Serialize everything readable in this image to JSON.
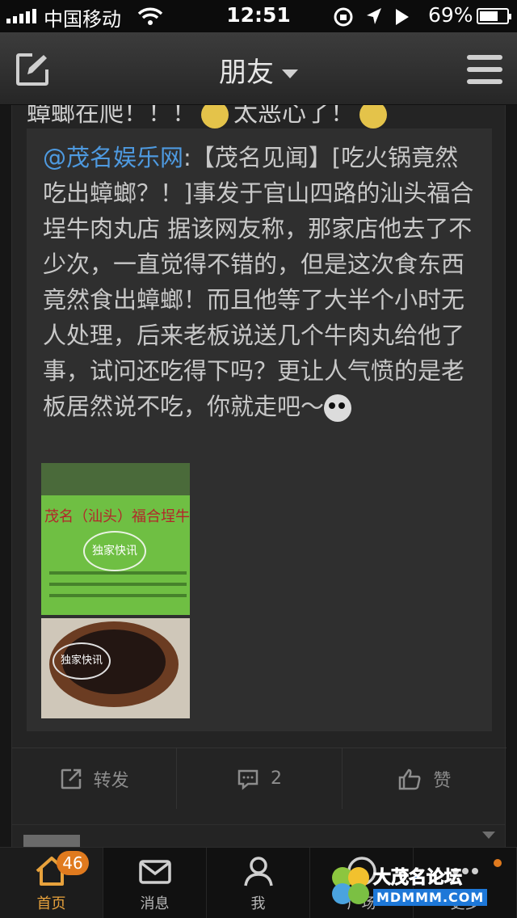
{
  "status_bar": {
    "carrier": "中国移动",
    "time": "12:51",
    "battery": "69%",
    "battery_level": 0.69
  },
  "nav": {
    "title": "朋友",
    "icons": [
      "compose-icon",
      "dropdown-caret-icon",
      "menu-icon"
    ]
  },
  "post": {
    "previous_text_prefix": "蟑螂在爬！！！",
    "previous_text_suffix": "太恶心了！",
    "repost": {
      "mention": "@茂名娱乐网",
      "text": ":【茂名见闻】[吃火锅竟然吃出蟑螂？！]事发于官山四路的汕头福合埕牛肉丸店 据该网友称，那家店他去了不少次，一直觉得不错的，但是这次食东西竟然食出蟑螂！而且他等了大半个小时无人处理，后来老板说送几个牛肉丸给他了事，试问还吃得下吗？更让人气愤的是老板居然说不吃，你就走吧～",
      "photo1": {
        "sign_text": "茂名（汕头）福合埕牛肉丸",
        "stamp": "独家快讯"
      },
      "photo2": {
        "stamp": "独家快讯"
      }
    },
    "actions": [
      {
        "label": "转发",
        "icon": "repost-icon"
      },
      {
        "label": "2",
        "icon": "comment-icon"
      },
      {
        "label": "赞",
        "icon": "like-icon"
      }
    ]
  },
  "tabs": [
    {
      "label": "首页",
      "icon": "home-icon",
      "badge": "46",
      "active": true
    },
    {
      "label": "消息",
      "icon": "message-icon"
    },
    {
      "label": "我",
      "icon": "profile-icon"
    },
    {
      "label": "广场",
      "icon": "discover-icon"
    },
    {
      "label": "更多",
      "icon": "more-icon"
    }
  ],
  "watermark": {
    "title": "大茂名论坛",
    "url": "MDMMM.COM"
  },
  "colors": {
    "accent": "#e07a1e",
    "mention": "#4e9ae0",
    "background": "#1b1b1b"
  }
}
